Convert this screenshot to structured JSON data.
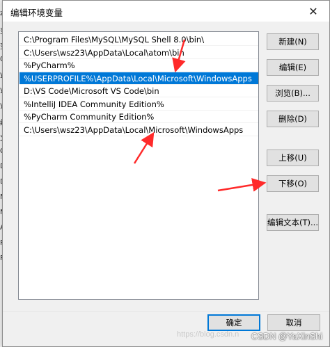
{
  "window": {
    "title": "编辑环境变量",
    "close_icon": "close-icon"
  },
  "paths": [
    {
      "value": "C:\\Program Files\\MySQL\\MySQL Shell 8.0\\bin\\",
      "selected": false
    },
    {
      "value": "C:\\Users\\wsz23\\AppData\\Local\\atom\\bin",
      "selected": false
    },
    {
      "value": "%PyCharm%",
      "selected": false
    },
    {
      "value": "%USERPROFILE%\\AppData\\Local\\Microsoft\\WindowsApps",
      "selected": true
    },
    {
      "value": "D:\\VS Code\\Microsoft VS Code\\bin",
      "selected": false
    },
    {
      "value": "%IntelliJ IDEA Community Edition%",
      "selected": false
    },
    {
      "value": "%PyCharm Community Edition%",
      "selected": false
    },
    {
      "value": "C:\\Users\\wsz23\\AppData\\Local\\Microsoft\\WindowsApps",
      "selected": false
    }
  ],
  "buttons": {
    "new": "新建(N)",
    "edit": "编辑(E)",
    "browse": "浏览(B)...",
    "delete": "删除(D)",
    "move_up": "上移(U)",
    "move_down": "下移(O)",
    "edit_text": "编辑文本(T)...",
    "ok": "确定",
    "cancel": "取消"
  },
  "background_window": {
    "glyphs": [
      "z",
      "变",
      "变",
      "0",
      "y",
      "y",
      "y",
      "统",
      "文",
      "C",
      "D",
      "D",
      "N",
      "N",
      "A",
      "P",
      "P"
    ]
  },
  "watermark": {
    "faint": "https://blog.csdn.n",
    "csdn": "CSDN @YaXinShi"
  },
  "colors": {
    "selection": "#0078d7",
    "annotation_arrow": "#ff2a2a"
  }
}
